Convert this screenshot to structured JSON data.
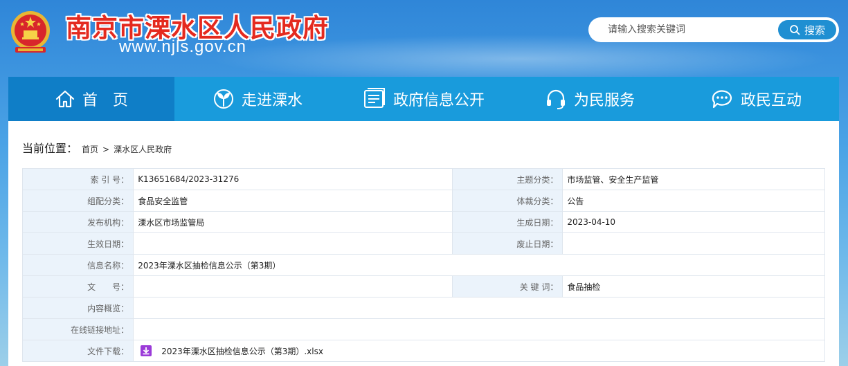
{
  "header": {
    "site_title": "南京市溧水区人民政府",
    "site_url": "www.njls.gov.cn",
    "search_placeholder": "请输入搜索关键词",
    "search_button": "搜索"
  },
  "nav": {
    "items": [
      {
        "label": "首　页",
        "icon": "home-icon"
      },
      {
        "label": "走进溧水",
        "icon": "sprout-icon"
      },
      {
        "label": "政府信息公开",
        "icon": "document-icon"
      },
      {
        "label": "为民服务",
        "icon": "headset-icon"
      },
      {
        "label": "政民互动",
        "icon": "chat-icon"
      }
    ]
  },
  "breadcrumb": {
    "label": "当前位置：",
    "home": "首页",
    "sep": ">",
    "current": "溧水区人民政府"
  },
  "meta": {
    "index_label": "索 引 号：",
    "index_value": "K13651684/2023-31276",
    "topic_label": "主题分类：",
    "topic_value": "市场监管、安全生产监管",
    "org_cat_label": "组配分类：",
    "org_cat_value": "食品安全监管",
    "genre_label": "体裁分类：",
    "genre_value": "公告",
    "publisher_label": "发布机构：",
    "publisher_value": "溧水区市场监管局",
    "created_label": "生成日期：",
    "created_value": "2023-04-10",
    "effective_label": "生效日期：",
    "effective_value": "",
    "abolished_label": "废止日期：",
    "abolished_value": "",
    "name_label": "信息名称：",
    "name_value": "2023年溧水区抽检信息公示（第3期）",
    "doc_no_label": "文　　号：",
    "doc_no_value": "",
    "keywords_label": "关 键 词：",
    "keywords_value": "食品抽检",
    "summary_label": "内容概览：",
    "summary_value": "",
    "online_link_label": "在线链接地址：",
    "online_link_value": "",
    "download_label": "文件下载：",
    "download_file": "2023年溧水区抽检信息公示（第3期）.xlsx"
  },
  "colors": {
    "nav_bg": "#199bdc",
    "nav_active": "#0f7ec7",
    "title_red": "#e42a1f",
    "label_bg": "#ebf3fb",
    "download_icon": "#9b3bd8"
  }
}
